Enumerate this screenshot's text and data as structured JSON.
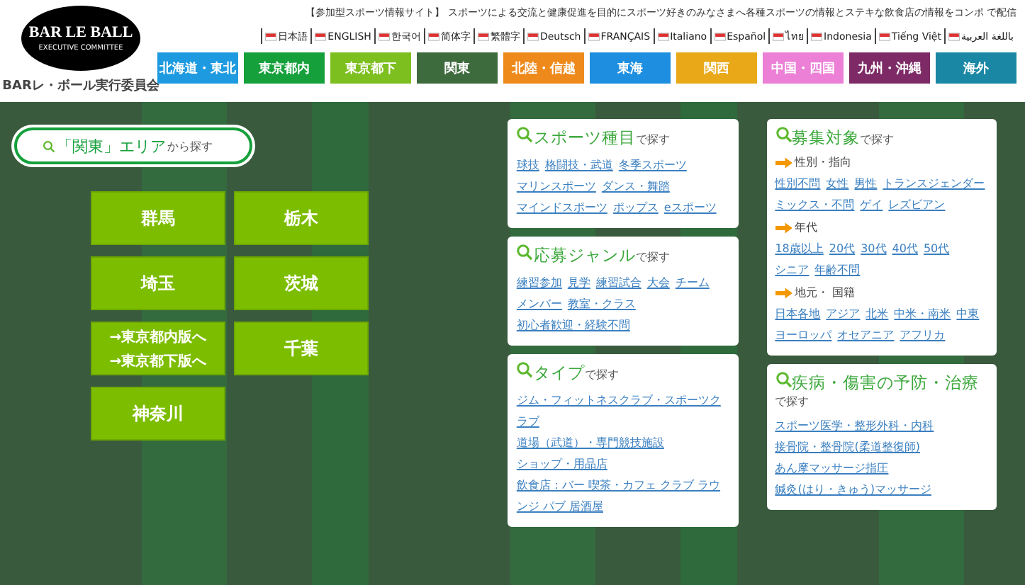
{
  "header": {
    "logo": {
      "title": "BAR LE BALL",
      "subtitle": "EXECUTIVE COMMITTEE"
    },
    "org_name": "BARレ・ボール実行委員会",
    "tagline": "【参加型スポーツ情報サイト】 スポーツによる交流と健康促進を目的にスポーツ好きのみなさまへ各種スポーツの情報とステキな飲食店の情報をコンポ で配信",
    "languages": [
      {
        "label": "日本語"
      },
      {
        "label": "ENGLISH"
      },
      {
        "label": "한국어"
      },
      {
        "label": "简体字"
      },
      {
        "label": "繁體字"
      },
      {
        "label": "Deutsch"
      },
      {
        "label": "FRANÇAIS"
      },
      {
        "label": "Italiano"
      },
      {
        "label": "Español"
      },
      {
        "label": "ไทย"
      },
      {
        "label": "Indonesia"
      },
      {
        "label": "Tiếng Việt"
      },
      {
        "label": "باللغة العربية"
      }
    ],
    "regions": [
      {
        "label": "北海道・東北",
        "color": "#1e9be0"
      },
      {
        "label": "東京都内",
        "color": "#16a03c"
      },
      {
        "label": "東京都下",
        "color": "#7dbf1f"
      },
      {
        "label": "関東",
        "color": "#3d6b3d"
      },
      {
        "label": "北陸・信越",
        "color": "#ee8a1c"
      },
      {
        "label": "東海",
        "color": "#1e8fe0"
      },
      {
        "label": "関西",
        "color": "#e8a818"
      },
      {
        "label": "中国・四国",
        "color": "#ec7fd6"
      },
      {
        "label": "九州・沖縄",
        "color": "#7d2a66"
      },
      {
        "label": "海外",
        "color": "#1a87a5"
      }
    ]
  },
  "area_search": {
    "label": "「関東」エリア",
    "suffix": "から探す"
  },
  "prefectures": [
    {
      "kind": "single",
      "label": "群馬"
    },
    {
      "kind": "single",
      "label": "栃木"
    },
    {
      "kind": "single",
      "label": "埼玉"
    },
    {
      "kind": "single",
      "label": "茨城"
    },
    {
      "kind": "links",
      "lines": [
        "→東京都内版へ",
        "→東京都下版へ"
      ]
    },
    {
      "kind": "single",
      "label": "千葉"
    },
    {
      "kind": "single",
      "label": "神奈川"
    }
  ],
  "cards_left": [
    {
      "title": "スポーツ種目",
      "suffix": "で探す",
      "groups": [
        {
          "links": [
            "球技",
            "格闘技・武道",
            "冬季スポーツ",
            "マリンスポーツ",
            "ダンス・舞踏",
            "マインドスポーツ",
            "ポップス",
            "eスポーツ"
          ]
        }
      ]
    },
    {
      "title": "応募ジャンル",
      "suffix": "で探す",
      "groups": [
        {
          "links": [
            "練習参加",
            "見学",
            "練習試合",
            "大会",
            "チーム",
            "メンバー",
            "教室・クラス",
            "初心者歓迎・経験不問"
          ]
        }
      ]
    },
    {
      "title": "タイプ",
      "suffix": "で探す",
      "groups": [
        {
          "links": [
            "ジム・フィットネスクラブ・スポーツクラブ",
            "道場（武道）・専門競技施設",
            "ショップ・用品店",
            "飲食店：バー 喫茶・カフェ クラブ ラウンジ パブ 居酒屋"
          ]
        }
      ]
    }
  ],
  "cards_right": [
    {
      "title": "募集対象",
      "suffix": "で探す",
      "groups": [
        {
          "heading": "性別・指向",
          "links": [
            "性別不問",
            "女性",
            "男性",
            "トランスジェンダー",
            "ミックス・不問",
            "ゲイ",
            "レズビアン"
          ]
        },
        {
          "heading": "年代",
          "links": [
            "18歳以上",
            "20代",
            "30代",
            "40代",
            "50代",
            "シニア",
            "年齢不問"
          ]
        },
        {
          "heading": "地元・ 国籍",
          "links": [
            "日本各地",
            "アジア",
            "北米",
            "中米・南米",
            "中東",
            "ヨーロッパ",
            "オセアニア",
            "アフリカ"
          ]
        }
      ]
    },
    {
      "title": "疾病・傷害の予防・治療",
      "suffix": "で探す",
      "groups": [
        {
          "links": [
            "スポーツ医学・整形外科・内科",
            "接骨院・整骨院(柔道整復師)",
            "あん摩マッサージ指圧",
            "鍼灸(はり・きゅう)マッサージ"
          ]
        }
      ]
    }
  ]
}
